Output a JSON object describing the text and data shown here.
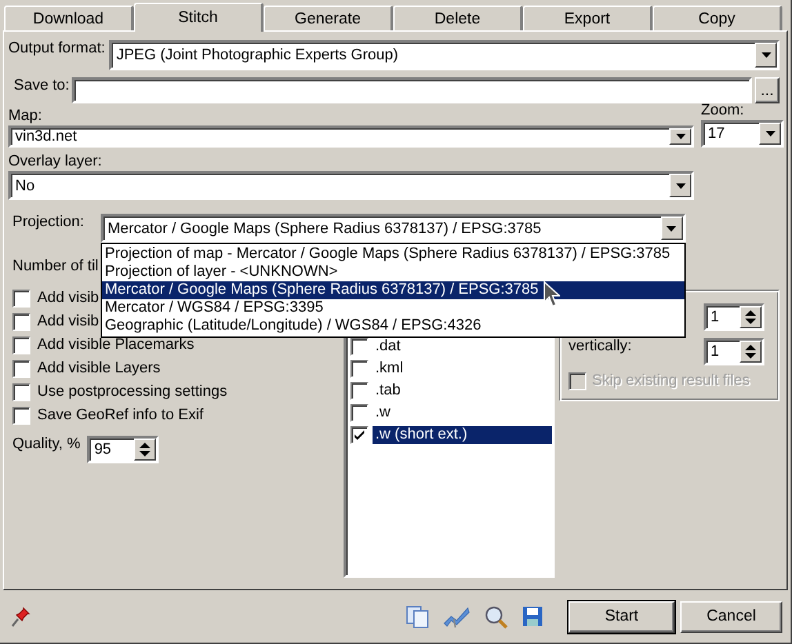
{
  "tabs": [
    {
      "label": "Download",
      "selected": false
    },
    {
      "label": "Stitch",
      "selected": true
    },
    {
      "label": "Generate",
      "selected": false
    },
    {
      "label": "Delete",
      "selected": false
    },
    {
      "label": "Export",
      "selected": false
    },
    {
      "label": "Copy",
      "selected": false
    }
  ],
  "output_format": {
    "label": "Output format:",
    "value": "JPEG (Joint Photographic Experts Group)"
  },
  "save_to": {
    "label": "Save to:",
    "button": "..."
  },
  "map": {
    "label": "Map:",
    "value": "vin3d.net"
  },
  "zoom": {
    "label": "Zoom:",
    "value": "17"
  },
  "overlay_layer": {
    "label": "Overlay layer:",
    "value": "No"
  },
  "projection": {
    "label": "Projection:",
    "value": "Mercator / Google Maps (Sphere Radius 6378137) / EPSG:3785",
    "expanded": true,
    "options": [
      {
        "label": "Projection of map - Mercator / Google Maps (Sphere Radius 6378137) / EPSG:3785",
        "selected": false
      },
      {
        "label": "Projection of layer - <UNKNOWN>",
        "selected": false
      },
      {
        "label": "Mercator / Google Maps (Sphere Radius 6378137) / EPSG:3785",
        "selected": true
      },
      {
        "label": "Mercator / WGS84 / EPSG:3395",
        "selected": false
      },
      {
        "label": "Geographic (Latitude/Longitude) / WGS84 / EPSG:4326",
        "selected": false
      }
    ]
  },
  "number_of_tiles_label": "Number of til",
  "options": [
    {
      "label": "Add visib",
      "checked": false
    },
    {
      "label": "Add visib",
      "checked": false
    },
    {
      "label": "Add visible Placemarks",
      "checked": false
    },
    {
      "label": "Add visible Layers",
      "checked": false
    },
    {
      "label": "Use postprocessing settings",
      "checked": false
    },
    {
      "label": "Save GeoRef info to Exif",
      "checked": false
    }
  ],
  "quality": {
    "label": "Quality, %",
    "value": "95"
  },
  "formats": [
    {
      "label": ".dat",
      "checked": false,
      "selected": false
    },
    {
      "label": ".kml",
      "checked": false,
      "selected": false
    },
    {
      "label": ".tab",
      "checked": false,
      "selected": false
    },
    {
      "label": ".w",
      "checked": false,
      "selected": false
    },
    {
      "label": ".w (short ext.)",
      "checked": true,
      "selected": true
    }
  ],
  "split": {
    "rows": [
      {
        "value": "1"
      },
      {
        "label": "vertically:",
        "value": "1"
      }
    ],
    "skip_existing": {
      "label": "Skip existing result files",
      "checked": false,
      "disabled": true
    }
  },
  "buttons": [
    {
      "label": "Start",
      "default": true
    },
    {
      "label": "Cancel",
      "default": false
    }
  ]
}
